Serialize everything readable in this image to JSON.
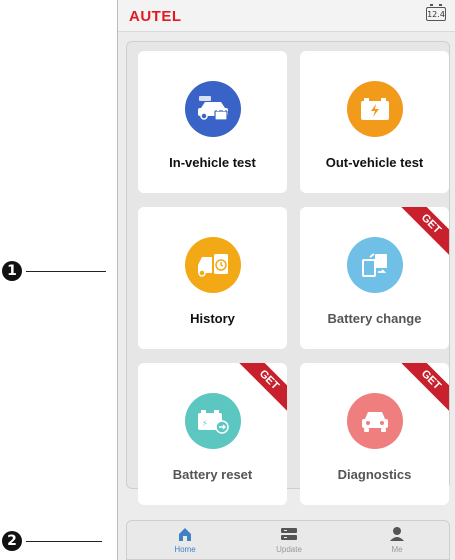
{
  "callouts": [
    "1",
    "2"
  ],
  "header": {
    "logo": "AUTEL",
    "battery_level": "12.4"
  },
  "tiles": [
    {
      "label": "In-vehicle test",
      "icon": "car-battery-icon",
      "color": "#3a63c8",
      "badge": ""
    },
    {
      "label": "Out-vehicle test",
      "icon": "battery-icon",
      "color": "#f29a1a",
      "badge": ""
    },
    {
      "label": "History",
      "icon": "history-icon",
      "color": "#f2a915",
      "badge": ""
    },
    {
      "label": "Battery change",
      "icon": "battery-change-icon",
      "color": "#6fbfe6",
      "badge": "GET"
    },
    {
      "label": "Battery reset",
      "icon": "battery-reset-icon",
      "color": "#5cc6c1",
      "badge": "GET"
    },
    {
      "label": "Diagnostics",
      "icon": "car-icon",
      "color": "#ef7f7f",
      "badge": "GET"
    }
  ],
  "nav": [
    {
      "label": "Home",
      "icon": "home-icon",
      "active": true
    },
    {
      "label": "Update",
      "icon": "update-icon",
      "active": false
    },
    {
      "label": "Me",
      "icon": "user-icon",
      "active": false
    }
  ],
  "colors": {
    "brand": "#e21a22",
    "ribbon": "#c8202c",
    "active_nav": "#3e82c4"
  }
}
